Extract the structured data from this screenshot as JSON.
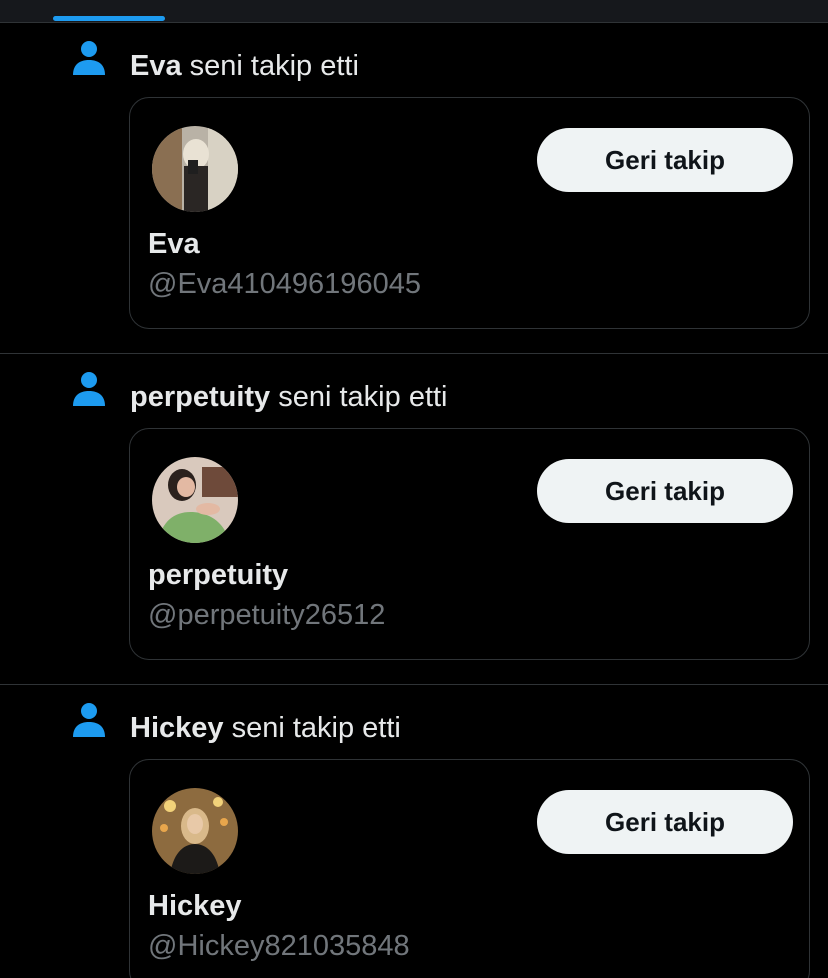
{
  "colors": {
    "accent": "#1d9bf0",
    "background": "#000000",
    "border": "#2f3336",
    "text_primary": "#e7e9ea",
    "text_secondary": "#71767b",
    "button_bg": "#eff3f4",
    "button_text": "#0f1419"
  },
  "notifications": [
    {
      "icon": "person-icon",
      "name": "Eva",
      "action": " seni takip etti",
      "card": {
        "display_name": "Eva",
        "handle": "@Eva410496196045",
        "button_label": "Geri takip"
      }
    },
    {
      "icon": "person-icon",
      "name": "perpetuity",
      "action": " seni takip etti",
      "card": {
        "display_name": "perpetuity",
        "handle": "@perpetuity26512",
        "button_label": "Geri takip"
      }
    },
    {
      "icon": "person-icon",
      "name": "Hickey",
      "action": " seni takip etti",
      "card": {
        "display_name": "Hickey",
        "handle": "@Hickey821035848",
        "button_label": "Geri takip"
      }
    }
  ]
}
